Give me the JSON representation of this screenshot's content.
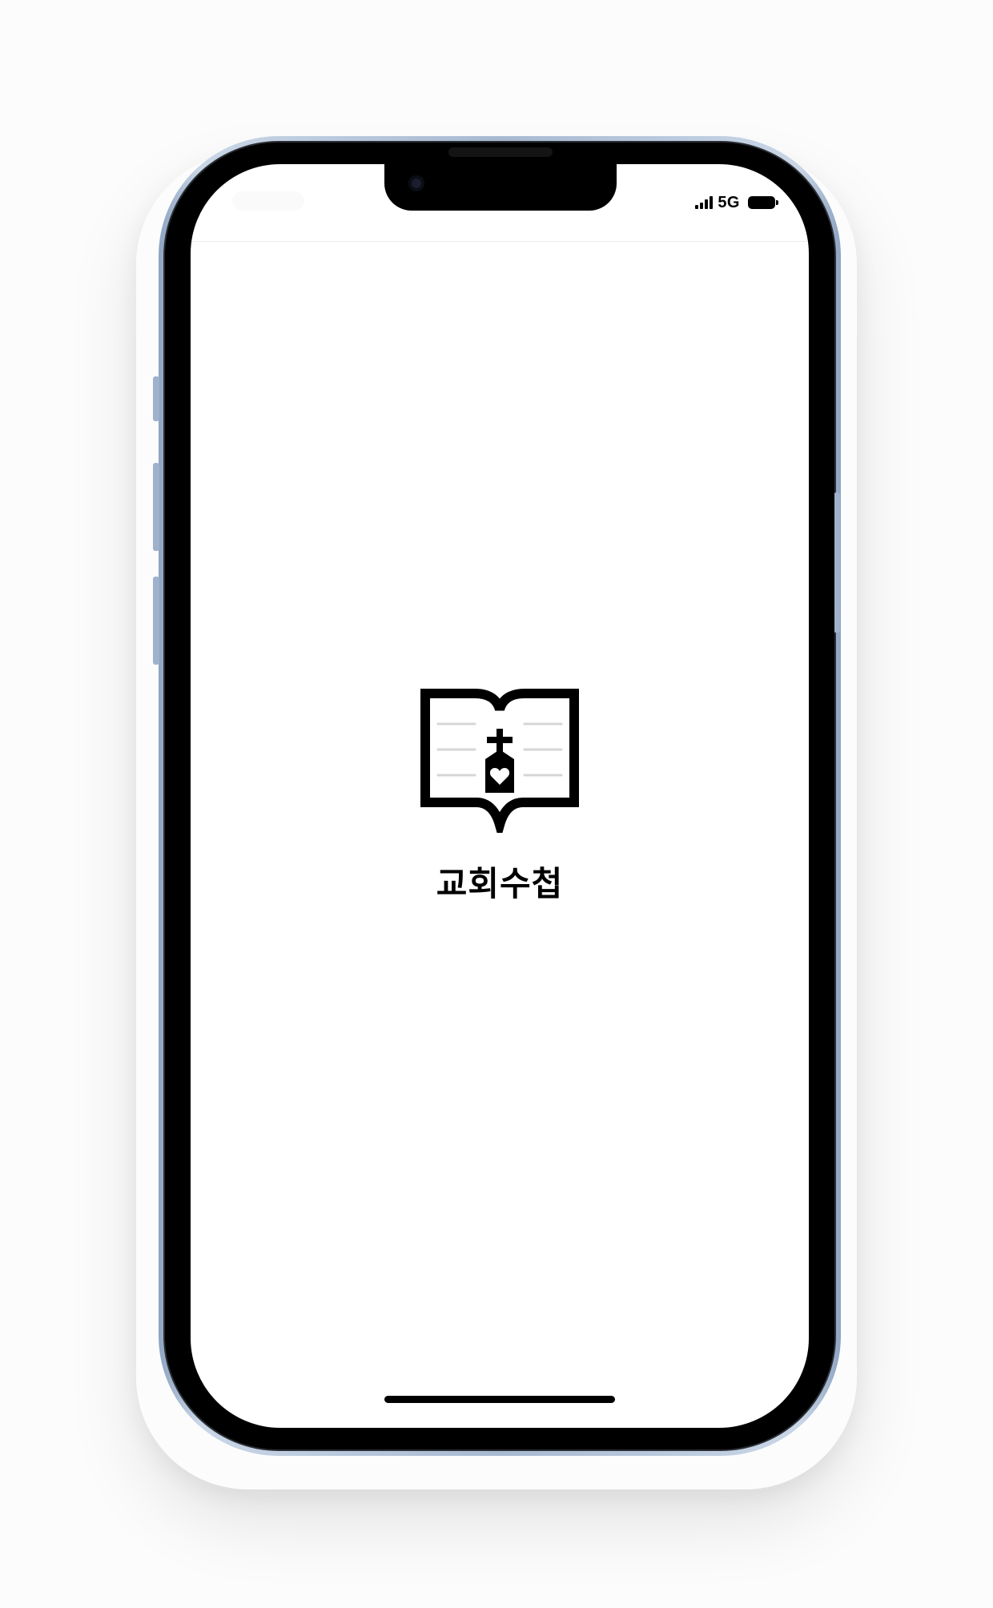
{
  "status_bar": {
    "network": "5G",
    "signal_bars": 4,
    "battery_level": 1.0,
    "icons": [
      "signal-icon",
      "battery-icon"
    ]
  },
  "splash": {
    "logo_icon": "bible-church-icon",
    "app_name": "교회수첩"
  },
  "colors": {
    "background": "#ffffff",
    "logo": "#000000",
    "page_lines": "#d6d6d6"
  }
}
